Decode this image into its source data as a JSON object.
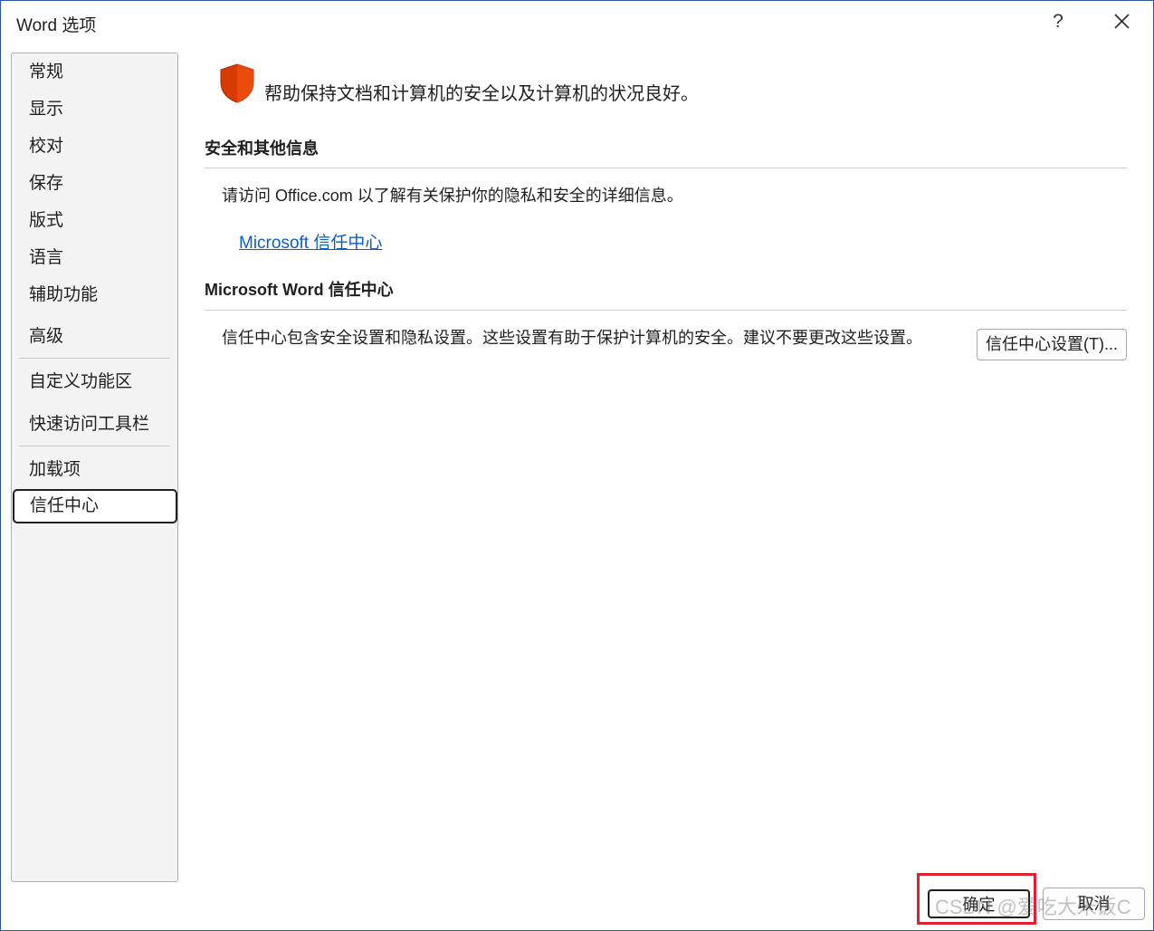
{
  "window": {
    "title": "Word 选项",
    "help_label": "?"
  },
  "sidebar": {
    "items": [
      {
        "label": "常规"
      },
      {
        "label": "显示"
      },
      {
        "label": "校对"
      },
      {
        "label": "保存"
      },
      {
        "label": "版式"
      },
      {
        "label": "语言"
      },
      {
        "label": "辅助功能"
      },
      {
        "label": "高级"
      },
      {
        "label": "自定义功能区"
      },
      {
        "label": "快速访问工具栏"
      },
      {
        "label": "加载项"
      },
      {
        "label": "信任中心"
      }
    ],
    "selected": "信任中心"
  },
  "main": {
    "header_text": "帮助保持文档和计算机的安全以及计算机的状况良好。",
    "security_section": {
      "title": "安全和其他信息",
      "text": "请访问 Office.com  以了解有关保护你的隐私和安全的详细信息。",
      "link_label": "Microsoft 信任中心"
    },
    "trust_center_section": {
      "title": "Microsoft Word 信任中心",
      "text": "信任中心包含安全设置和隐私设置。这些设置有助于保护计算机的安全。建议不要更改这些设置。",
      "settings_button": "信任中心设置(T)..."
    }
  },
  "footer": {
    "ok_label": "确定",
    "cancel_label": "取消"
  },
  "watermark": "CSDN @爱吃大米饭C",
  "colors": {
    "accent": "#2b579a",
    "shield_red": "#d83b01",
    "link": "#0b5ec7",
    "highlight_red": "#e0202e"
  }
}
